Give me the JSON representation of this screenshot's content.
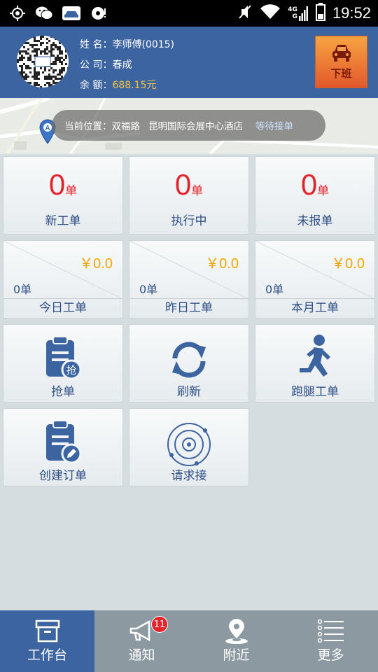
{
  "status_bar": {
    "time": "19:52",
    "network_top": "4G",
    "network_bottom": "G",
    "left_icons": [
      "location-target-icon",
      "wechat-icon",
      "car-app-icon",
      "record-icon"
    ],
    "right_icons": [
      "mute-icon",
      "wifi-icon",
      "signal-icon",
      "battery-icon"
    ]
  },
  "header": {
    "name_label": "姓 名：",
    "name_value": "李师傅(0015)",
    "company_label": "公 司：",
    "company_value": "春成",
    "balance_label": "余 额：",
    "balance_value": "688.15元",
    "off_duty_label": "下班",
    "colors": {
      "header_bg": "#3c64a0",
      "money": "#f6c63f"
    }
  },
  "location": {
    "label": "当前位置：",
    "road": "双福路",
    "place": "昆明国际会展中心酒店",
    "status": "等待接单",
    "pin_letter": "A"
  },
  "orders": [
    {
      "count": "0",
      "unit": "单",
      "label": "新工单"
    },
    {
      "count": "0",
      "unit": "单",
      "label": "执行中"
    },
    {
      "count": "0",
      "unit": "单",
      "label": "未报单"
    }
  ],
  "stats": [
    {
      "amount": "￥0.0",
      "count": "0单",
      "label": "今日工单"
    },
    {
      "amount": "￥0.0",
      "count": "0单",
      "label": "昨日工单"
    },
    {
      "amount": "￥0.0",
      "count": "0单",
      "label": "本月工单"
    }
  ],
  "actions": [
    {
      "label": "抢单",
      "icon": "clipboard-grab-icon",
      "icon_text": "抢"
    },
    {
      "label": "刷新",
      "icon": "refresh-icon"
    },
    {
      "label": "跑腿工单",
      "icon": "running-man-icon"
    },
    {
      "label": "创建订单",
      "icon": "clipboard-edit-icon"
    },
    {
      "label": "请求接",
      "icon": "radar-icon"
    }
  ],
  "bottom_nav": [
    {
      "label": "工作台",
      "icon": "archive-box-icon",
      "active": true
    },
    {
      "label": "通知",
      "icon": "megaphone-icon",
      "badge": "11"
    },
    {
      "label": "附近",
      "icon": "map-pin-icon"
    },
    {
      "label": "更多",
      "icon": "list-menu-icon"
    }
  ],
  "colors": {
    "accent_blue": "#3c64a0",
    "text_blue": "#2e4f86",
    "count_red": "#e4232a",
    "amount_orange": "#f4a400",
    "nav_bg": "#8d99a1"
  }
}
